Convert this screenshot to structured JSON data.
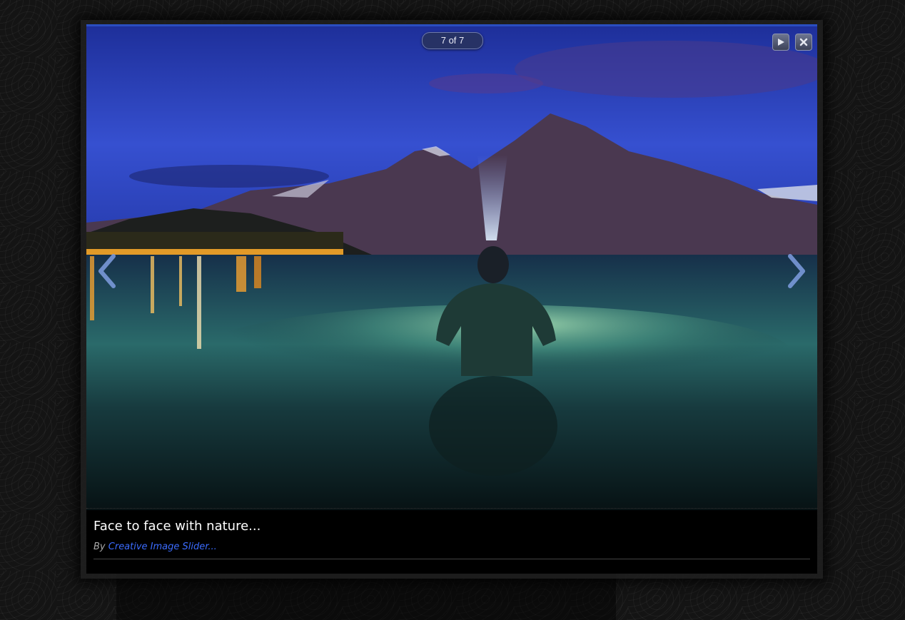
{
  "lightbox": {
    "counter": "7 of 7",
    "caption": {
      "title": "Face to face with nature...",
      "by_prefix": "By",
      "author_link": "Creative Image Slider..."
    },
    "controls": {
      "play_icon": "play-icon",
      "close_icon": "close-icon",
      "prev_icon": "chevron-left-icon",
      "next_icon": "chevron-right-icon"
    },
    "colors": {
      "accent": "#2a4ec0",
      "link": "#3b6cff",
      "caption_bg": "#000000"
    }
  }
}
